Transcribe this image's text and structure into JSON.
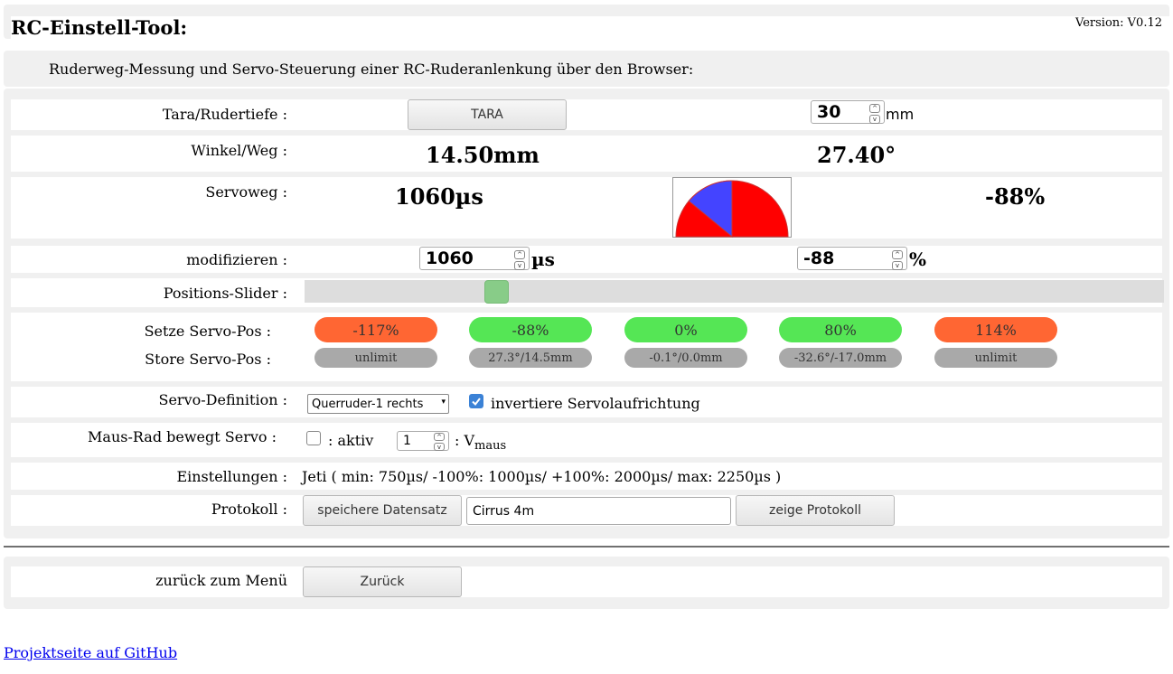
{
  "header": {
    "title": "RC-Einstell-Tool:",
    "version": "Version: V0.12"
  },
  "subtitle": "Ruderweg-Messung und Servo-Steuerung einer RC-Ruderanlenkung über den Browser:",
  "tara": {
    "label": "Tara/Rudertiefe :",
    "button": "TARA",
    "depth_value": "30",
    "unit": "mm"
  },
  "winkel": {
    "label": "Winkel/Weg :",
    "weg": "14.50mm",
    "winkel": "27.40°"
  },
  "servoweg": {
    "label": "Servoweg :",
    "us": "1060µs",
    "percent": "-88%",
    "gauge": {
      "fraction": 0.94,
      "red": "#ff0000",
      "blue": "#4444ff"
    }
  },
  "modify": {
    "label": "modifizieren :",
    "us_value": "1060",
    "us_unit": "µs",
    "pct_value": "-88",
    "pct_unit": "%"
  },
  "slider": {
    "label": "Positions-Slider :",
    "fraction": 0.215
  },
  "servo_pos": {
    "set_label": "Setze Servo-Pos :",
    "store_label": "Store Servo-Pos :",
    "set": [
      {
        "label": "-117%",
        "color": "orange"
      },
      {
        "label": "-88%",
        "color": "green"
      },
      {
        "label": "0%",
        "color": "green"
      },
      {
        "label": "80%",
        "color": "green"
      },
      {
        "label": "114%",
        "color": "orange"
      }
    ],
    "store": [
      "unlimit",
      "27.3°/14.5mm",
      "-0.1°/0.0mm",
      "-32.6°/-17.0mm",
      "unlimit"
    ]
  },
  "servo_def": {
    "label": "Servo-Definition :",
    "selected": "Querruder-1 rechts",
    "invert_label": "invertiere Servolaufrichtung",
    "invert_checked": true
  },
  "maus": {
    "label": "Maus-Rad bewegt Servo :",
    "aktiv_label": ": aktiv",
    "speed": "1",
    "v_prefix": ": V",
    "v_sub": "maus"
  },
  "settings": {
    "label": "Einstellungen :",
    "text": "Jeti ( min: 750µs/ -100%: 1000µs/ +100%: 2000µs/ max: 2250µs )"
  },
  "protokoll": {
    "label": "Protokoll :",
    "save_button": "speichere Datensatz",
    "name_value": "Cirrus 4m",
    "show_button": "zeige Protokoll"
  },
  "back": {
    "label": "zurück zum Menü",
    "button": "Zurück"
  },
  "footer": {
    "link": "Projektseite auf GitHub"
  }
}
